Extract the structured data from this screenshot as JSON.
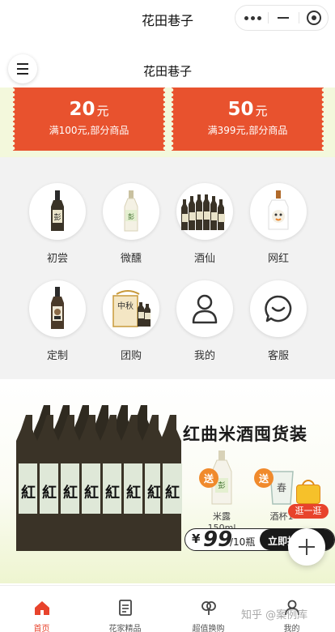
{
  "topbar": {
    "title": "花田巷子"
  },
  "header": {
    "title": "花田巷子"
  },
  "coupons": [
    {
      "amount": "20",
      "unit": "元",
      "condition": "满100元,部分商品"
    },
    {
      "amount": "50",
      "unit": "元",
      "condition": "满399元,部分商品"
    }
  ],
  "categories": [
    {
      "label": "初尝",
      "icon": "sake-bottle-icon"
    },
    {
      "label": "微醺",
      "icon": "milk-sake-bottle-icon"
    },
    {
      "label": "酒仙",
      "icon": "bottle-group-icon"
    },
    {
      "label": "网红",
      "icon": "cartoon-bottle-icon"
    },
    {
      "label": "定制",
      "icon": "custom-bottle-icon"
    },
    {
      "label": "团购",
      "icon": "gift-box-icon"
    },
    {
      "label": "我的",
      "icon": "user-icon"
    },
    {
      "label": "客服",
      "icon": "customer-service-icon"
    }
  ],
  "banner": {
    "title": "红曲米酒囤货装",
    "bottle_text": "紅",
    "badge": "送",
    "products": [
      {
        "label": "米露150ml"
      },
      {
        "label": "酒杯1"
      }
    ],
    "price_symbol": "¥",
    "price": "99",
    "price_unit": "/10瓶",
    "buy_label": "立即抢"
  },
  "shop_badge": {
    "label": "逛一逛"
  },
  "tabbar": {
    "items": [
      {
        "label": "首页",
        "icon": "home-icon",
        "active": true
      },
      {
        "label": "花家精品",
        "icon": "document-icon",
        "active": false
      },
      {
        "label": "超值换购",
        "icon": "exchange-icon",
        "active": false
      },
      {
        "label": "我的",
        "icon": "user-icon",
        "active": false
      }
    ]
  },
  "watermark": "知乎 @案例库",
  "colors": {
    "accent": "#e8432c",
    "coupon": "#e8522e",
    "band": "#f3f8dc",
    "grid_bg": "#f2f2f2"
  }
}
